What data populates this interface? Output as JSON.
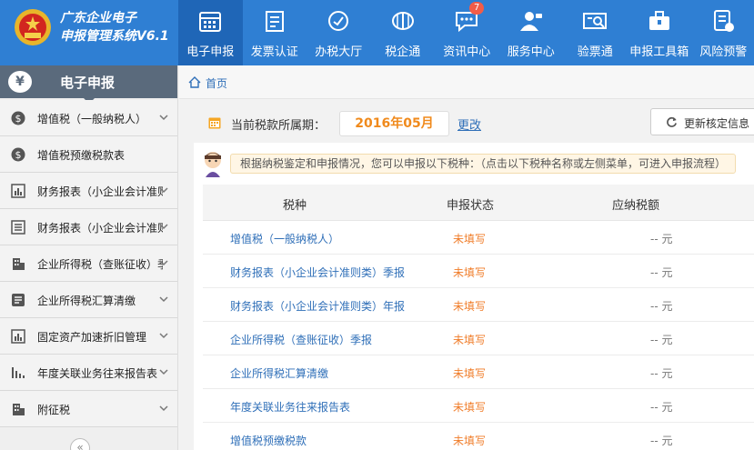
{
  "header": {
    "system_title_line1": "广东企业电子",
    "system_title_line2": "申报管理系统V6.1",
    "nav": [
      {
        "label": "电子申报",
        "icon": "calendar-grid-icon",
        "active": true
      },
      {
        "label": "发票认证",
        "icon": "invoice-icon"
      },
      {
        "label": "办税大厅",
        "icon": "hall-icon"
      },
      {
        "label": "税企通",
        "icon": "coin-stack-icon"
      },
      {
        "label": "资讯中心",
        "icon": "chat-bubble-icon",
        "badge": "7"
      },
      {
        "label": "服务中心",
        "icon": "customer-service-icon"
      },
      {
        "label": "验票通",
        "icon": "ticket-check-icon"
      },
      {
        "label": "申报工具箱",
        "icon": "toolbox-icon"
      },
      {
        "label": "风险预警",
        "icon": "warning-document-icon"
      }
    ]
  },
  "sidebar": {
    "title": "电子申报",
    "yen_symbol": "¥",
    "collapse_symbol": "«",
    "items": [
      {
        "label": "增值税（一般纳税人）",
        "icon": "dollar-circle-icon"
      },
      {
        "label": "增值税预缴税款表",
        "icon": "dollar-circle-icon"
      },
      {
        "label": "财务报表（小企业会计准则",
        "icon": "bar-chart-icon"
      },
      {
        "label": "财务报表（小企业会计准则",
        "icon": "list-table-icon"
      },
      {
        "label": "企业所得税（查账征收）季",
        "icon": "building-icon"
      },
      {
        "label": "企业所得税汇算清缴",
        "icon": "form-icon"
      },
      {
        "label": "固定资产加速折旧管理",
        "icon": "bar-chart-icon"
      },
      {
        "label": "年度关联业务往来报告表",
        "icon": "bar-chart-icon"
      },
      {
        "label": "附征税",
        "icon": "building-icon"
      }
    ]
  },
  "breadcrumb": {
    "home": "首页"
  },
  "period": {
    "label": "当前税款所属期：",
    "value": "2016年05月",
    "change": "更改",
    "refresh": "更新核定信息"
  },
  "tip": "根据纳税鉴定和申报情况，您可以申报以下税种：（点击以下税种名称或左侧菜单，可进入申报流程）",
  "table": {
    "columns": [
      "税种",
      "申报状态",
      "应纳税额"
    ],
    "rows": [
      {
        "name": "增值税（一般纳税人）",
        "status": "未填写",
        "amount": "-- 元"
      },
      {
        "name": "财务报表（小企业会计准则类）季报",
        "status": "未填写",
        "amount": "-- 元"
      },
      {
        "name": "财务报表（小企业会计准则类）年报",
        "status": "未填写",
        "amount": "-- 元"
      },
      {
        "name": "企业所得税（查账征收）季报",
        "status": "未填写",
        "amount": "-- 元"
      },
      {
        "name": "企业所得税汇算清缴",
        "status": "未填写",
        "amount": "-- 元"
      },
      {
        "name": "年度关联业务往来报告表",
        "status": "未填写",
        "amount": "-- 元"
      },
      {
        "name": "增值税预缴税款",
        "status": "未填写",
        "amount": "-- 元"
      }
    ]
  },
  "colors": {
    "header_blue": "#2f7fd3",
    "sidebar_head": "#5a6a7c",
    "link_blue": "#2f6fb8",
    "status_orange": "#f07d2a",
    "period_orange": "#f08a1c"
  }
}
